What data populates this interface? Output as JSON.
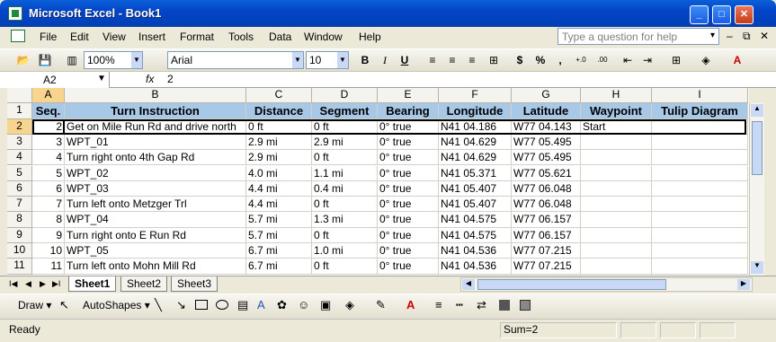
{
  "window": {
    "title": "Microsoft Excel - Book1"
  },
  "menu": [
    "File",
    "Edit",
    "View",
    "Insert",
    "Format",
    "Tools",
    "Data",
    "Window",
    "Help"
  ],
  "help_placeholder": "Type a question for help",
  "toolbar": {
    "zoom": "100%",
    "font": "Arial",
    "size": "10",
    "bold": "B",
    "italic": "I",
    "underline": "U",
    "currency": "$",
    "percent": "%",
    "comma": ","
  },
  "formula": {
    "namebox": "A2",
    "fx": "fx",
    "value": "2"
  },
  "columns": [
    "A",
    "B",
    "C",
    "D",
    "E",
    "F",
    "G",
    "H",
    "I"
  ],
  "header_row": [
    "Seq.",
    "Turn Instruction",
    "Distance",
    "Segment",
    "Bearing",
    "Longitude",
    "Latitude",
    "Waypoint",
    "Tulip Diagram"
  ],
  "rows": [
    [
      "1",
      "",
      "",
      "",
      "",
      "",
      "",
      "",
      ""
    ],
    [
      "2",
      "2",
      "Get on Mile Run Rd and drive north",
      "0 ft",
      "0 ft",
      "0° true",
      "N41 04.186",
      "W77 04.143",
      "Start"
    ],
    [
      "3",
      "3",
      "WPT_01",
      "2.9 mi",
      "2.9 mi",
      "0° true",
      "N41 04.629",
      "W77 05.495",
      ""
    ],
    [
      "4",
      "4",
      "Turn right onto 4th Gap Rd",
      "2.9 mi",
      "0 ft",
      "0° true",
      "N41 04.629",
      "W77 05.495",
      ""
    ],
    [
      "5",
      "5",
      "WPT_02",
      "4.0 mi",
      "1.1 mi",
      "0° true",
      "N41 05.371",
      "W77 05.621",
      ""
    ],
    [
      "6",
      "6",
      "WPT_03",
      "4.4 mi",
      "0.4 mi",
      "0° true",
      "N41 05.407",
      "W77 06.048",
      ""
    ],
    [
      "7",
      "7",
      "Turn left onto Metzger Trl",
      "4.4 mi",
      "0 ft",
      "0° true",
      "N41 05.407",
      "W77 06.048",
      ""
    ],
    [
      "8",
      "8",
      "WPT_04",
      "5.7 mi",
      "1.3 mi",
      "0° true",
      "N41 04.575",
      "W77 06.157",
      ""
    ],
    [
      "9",
      "9",
      "Turn right onto E Run Rd",
      "5.7 mi",
      "0 ft",
      "0° true",
      "N41 04.575",
      "W77 06.157",
      ""
    ],
    [
      "10",
      "10",
      "WPT_05",
      "6.7 mi",
      "1.0 mi",
      "0° true",
      "N41 04.536",
      "W77 07.215",
      ""
    ],
    [
      "11",
      "11",
      "Turn left onto Mohn Mill Rd",
      "6.7 mi",
      "0 ft",
      "0° true",
      "N41 04.536",
      "W77 07.215",
      ""
    ]
  ],
  "sheets": [
    "Sheet1",
    "Sheet2",
    "Sheet3"
  ],
  "draw": {
    "draw_label": "Draw",
    "autoshapes_label": "AutoShapes"
  },
  "status": {
    "left": "Ready",
    "sum": "Sum=2"
  }
}
